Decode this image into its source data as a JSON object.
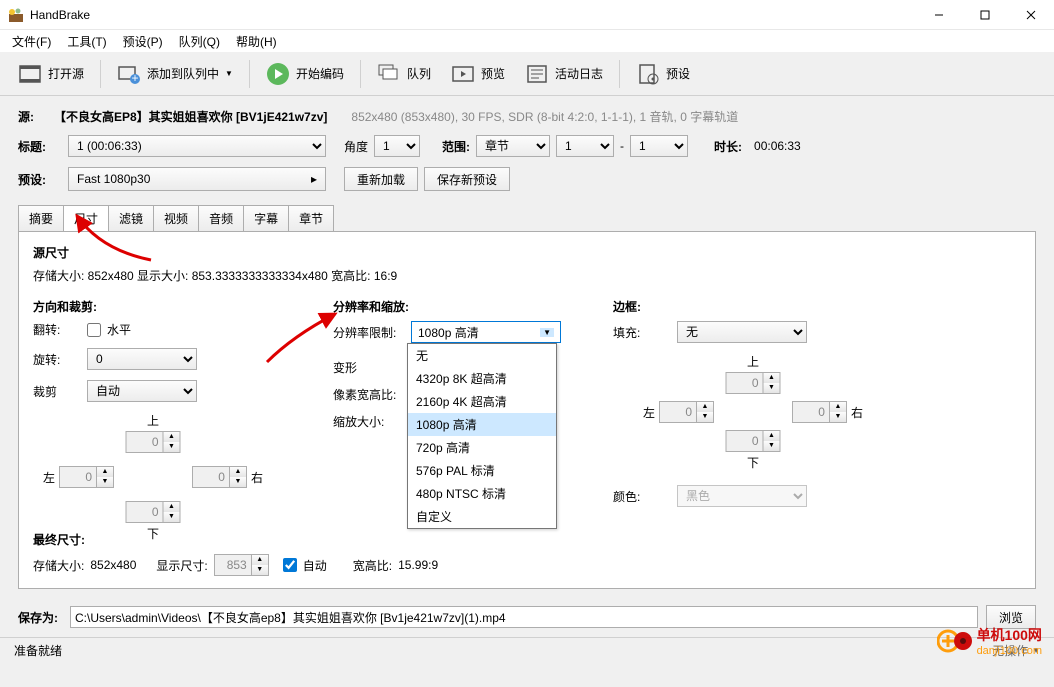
{
  "window": {
    "title": "HandBrake"
  },
  "menubar": {
    "file": "文件(F)",
    "tools": "工具(T)",
    "presets": "预设(P)",
    "queue": "队列(Q)",
    "help": "帮助(H)"
  },
  "toolbar": {
    "open_source": "打开源",
    "add_queue": "添加到队列中",
    "start_encode": "开始编码",
    "queue": "队列",
    "preview": "预览",
    "activity": "活动日志",
    "presets": "预设"
  },
  "source": {
    "label": "源:",
    "name": "【不良女高EP8】其实姐姐喜欢你 [BV1jE421w7zv]",
    "info": "852x480 (853x480), 30 FPS, SDR (8-bit 4:2:0, 1-1-1), 1 音轨, 0 字幕轨道"
  },
  "title": {
    "label": "标题:",
    "value": "1 (00:06:33)",
    "angle_label": "角度",
    "angle": "1",
    "range_label": "范围:",
    "range_type": "章节",
    "range_from": "1",
    "dash": "-",
    "range_to": "1",
    "duration_label": "时长:",
    "duration": "00:06:33"
  },
  "preset": {
    "label": "预设:",
    "value": "Fast 1080p30",
    "reload": "重新加载",
    "save_new": "保存新预设"
  },
  "tabs": {
    "summary": "摘要",
    "dimensions": "尺寸",
    "filters": "滤镜",
    "video": "视频",
    "audio": "音频",
    "subtitles": "字幕",
    "chapters": "章节"
  },
  "dims": {
    "source_size_title": "源尺寸",
    "source_size_text": "存储大小:   852x480 显示大小:   853.3333333333334x480 宽高比:   16:9",
    "orient_title": "方向和裁剪:",
    "flip": "翻转:",
    "flip_h": "水平",
    "rotate": "旋转:",
    "rotate_val": "0",
    "crop": "裁剪",
    "crop_val": "自动",
    "top": "上",
    "bottom": "下",
    "left": "左",
    "right": "右",
    "zero": "0",
    "res_title": "分辨率和缩放:",
    "res_limit": "分辨率限制:",
    "res_limit_val": "1080p 高清",
    "anamorphic": "变形",
    "par": "像素宽高比:",
    "scale": "缩放大小:",
    "dd_options": [
      "无",
      "4320p 8K 超高清",
      "2160p 4K 超高清",
      "1080p 高清",
      "720p 高清",
      "576p PAL 标清",
      "480p NTSC 标清",
      "自定义"
    ],
    "border_title": "边框:",
    "fill": "填充:",
    "fill_val": "无",
    "color": "颜色:",
    "color_val": "黑色",
    "final_title": "最终尺寸:",
    "final_storage": "存储大小:",
    "final_storage_val": "852x480",
    "final_display": "显示尺寸:",
    "final_display_val": "853",
    "auto": "自动",
    "final_ar": "宽高比:",
    "final_ar_val": "15.99:9"
  },
  "save": {
    "label": "保存为:",
    "path": "C:\\Users\\admin\\Videos\\【不良女高ep8】其实姐姐喜欢你 [Bv1je421w7zv](1).mp4",
    "browse": "浏览"
  },
  "status": {
    "ready": "准备就绪",
    "no_task": "无操作"
  },
  "watermark": {
    "line1": "单机100网",
    "line2": "danji100.com"
  }
}
